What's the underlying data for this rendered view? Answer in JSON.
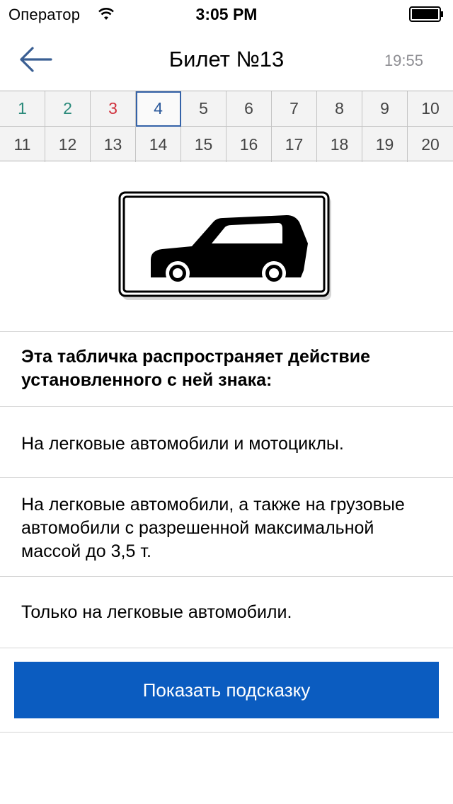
{
  "status_bar": {
    "carrier": "Оператор",
    "time": "3:05 PM"
  },
  "nav": {
    "title": "Билет №13",
    "timer": "19:55",
    "back_icon": "back-arrow-icon"
  },
  "question_grid": {
    "cells": [
      {
        "label": "1",
        "state": "correct"
      },
      {
        "label": "2",
        "state": "correct"
      },
      {
        "label": "3",
        "state": "wrong"
      },
      {
        "label": "4",
        "state": "current"
      },
      {
        "label": "5",
        "state": ""
      },
      {
        "label": "6",
        "state": ""
      },
      {
        "label": "7",
        "state": ""
      },
      {
        "label": "8",
        "state": ""
      },
      {
        "label": "9",
        "state": ""
      },
      {
        "label": "10",
        "state": ""
      },
      {
        "label": "11",
        "state": ""
      },
      {
        "label": "12",
        "state": ""
      },
      {
        "label": "13",
        "state": ""
      },
      {
        "label": "14",
        "state": ""
      },
      {
        "label": "15",
        "state": ""
      },
      {
        "label": "16",
        "state": ""
      },
      {
        "label": "17",
        "state": ""
      },
      {
        "label": "18",
        "state": ""
      },
      {
        "label": "19",
        "state": ""
      },
      {
        "label": "20",
        "state": ""
      }
    ]
  },
  "question": {
    "image_icon": "car-plate-sign-icon",
    "text": "Эта табличка распространяет действие установленного с ней знака:"
  },
  "answers": [
    {
      "text": "На легковые автомобили и мотоциклы."
    },
    {
      "text": "На легковые автомобили, а также на грузовые автомобили с разрешенной максимальной массой до 3,5 т."
    },
    {
      "text": "Только на легковые автомобили."
    }
  ],
  "hint_button": {
    "label": "Показать подсказку",
    "color": "#0b5cc0"
  },
  "colors": {
    "correct": "#2a8a7a",
    "wrong": "#d0303c",
    "current": "#2c5a9c"
  }
}
